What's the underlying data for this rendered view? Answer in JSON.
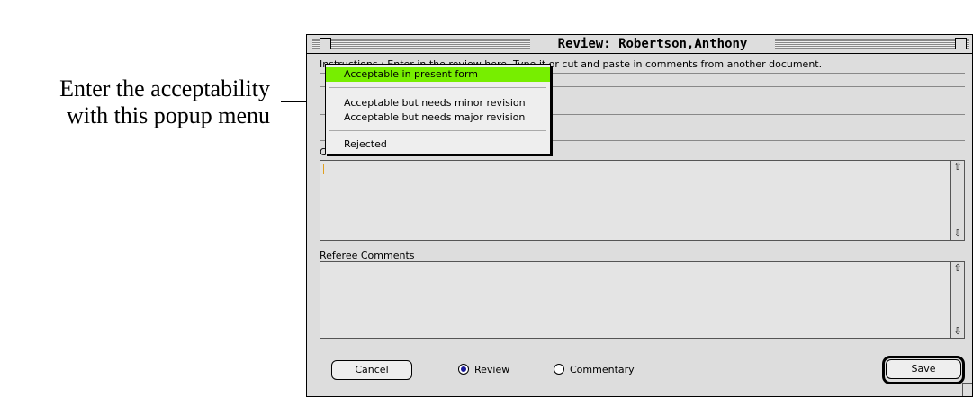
{
  "callout": {
    "line1": "Enter the acceptability",
    "line2": "with this popup menu"
  },
  "window": {
    "title": "Review: Robertson,Anthony",
    "instructions": "Instructions : Enter in the review here. Type it or cut and paste in comments from another document."
  },
  "popup_menu": {
    "items": [
      "Acceptable in present form",
      "Acceptable but needs minor revision",
      "Acceptable but needs major revision",
      "Rejected"
    ],
    "selected_index": 0
  },
  "confidential": {
    "label": "Confidential Comments",
    "value": ""
  },
  "referee": {
    "label": "Referee Comments",
    "value": ""
  },
  "footer": {
    "cancel_label": "Cancel",
    "save_label": "Save",
    "radio_review_label": "Review",
    "radio_commentary_label": "Commentary",
    "selected_radio": "Review"
  },
  "icons": {
    "scroll_up": "up-arrow-icon",
    "scroll_down": "down-arrow-icon"
  },
  "colors": {
    "selected_item": "#77ee00",
    "window_bg": "#dddddd"
  }
}
